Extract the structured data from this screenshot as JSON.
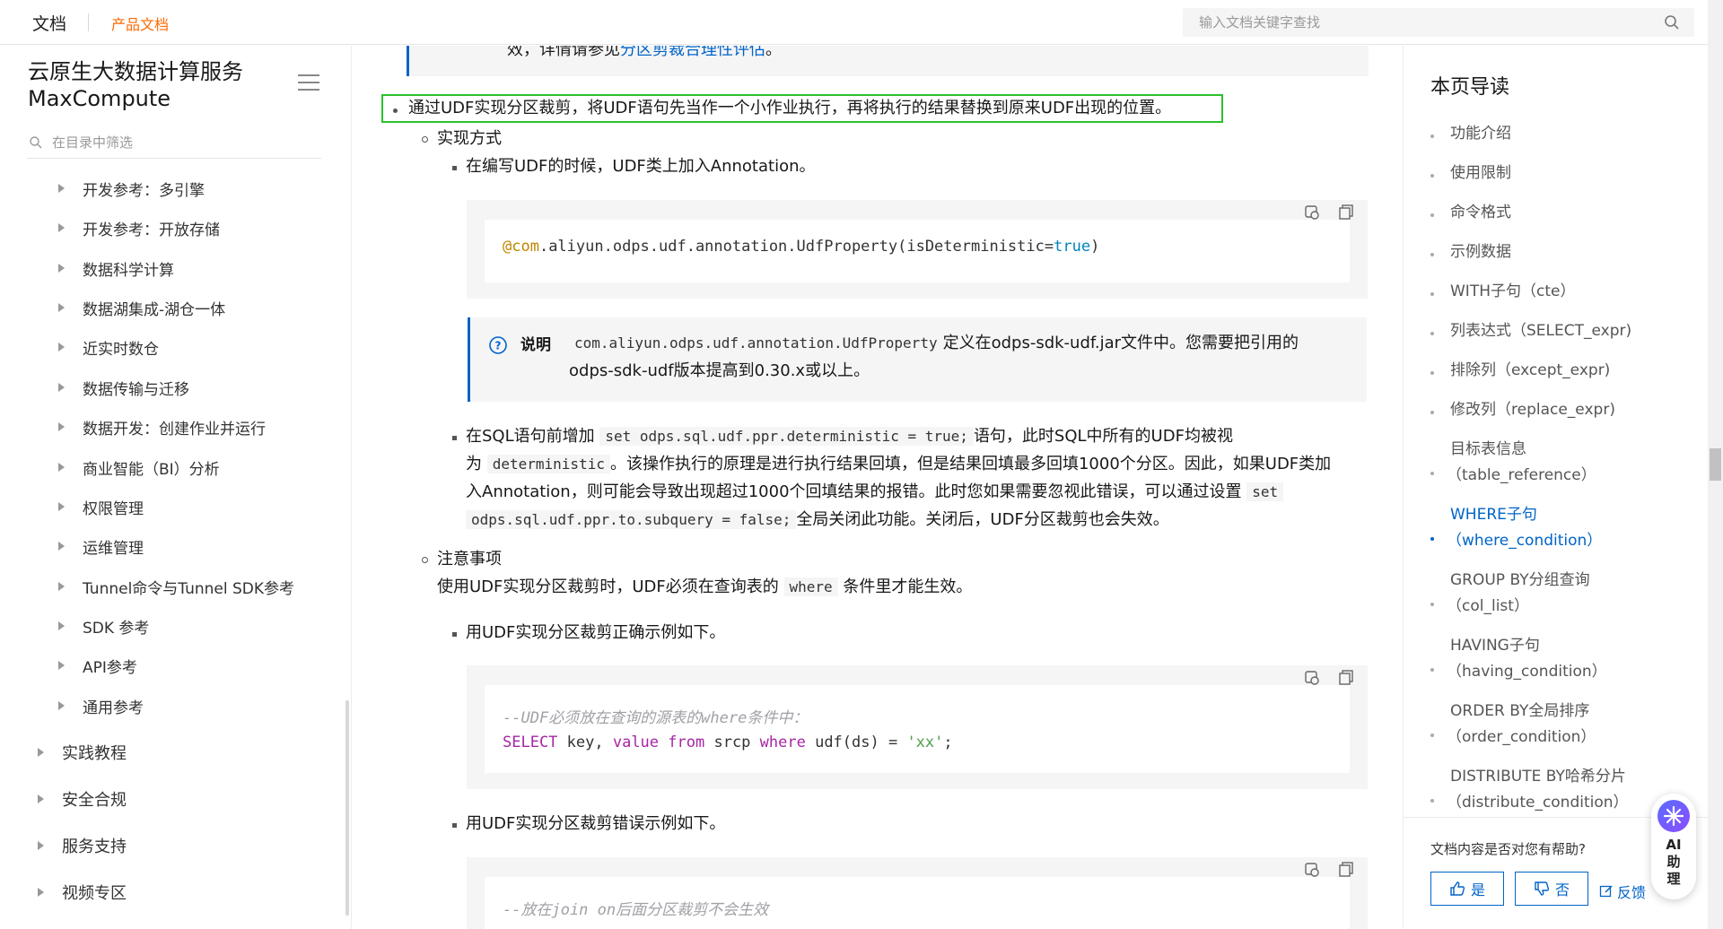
{
  "topbar": {
    "brand": "文档",
    "product": "产品文档",
    "search_placeholder": "输入文档关键字查找"
  },
  "sidebar": {
    "title_line1": "云原生大数据计算服务",
    "title_line2": "MaxCompute",
    "filter_placeholder": "在目录中筛选",
    "items": [
      "开发参考：多引擎",
      "开发参考：开放存储",
      "数据科学计算",
      "数据湖集成-湖仓一体",
      "近实时数仓",
      "数据传输与迁移",
      "数据开发：创建作业并运行",
      "商业智能（BI）分析",
      "权限管理",
      "运维管理",
      "Tunnel命令与Tunnel SDK参考",
      "SDK 参考",
      "API参考",
      "通用参考"
    ],
    "top_items": [
      "实践教程",
      "安全合规",
      "服务支持",
      "视频专区"
    ]
  },
  "content": {
    "top_fragment_a": "效，详情请参见",
    "top_fragment_link": "分区剪裁合理性评估",
    "top_fragment_b": "。",
    "udf_bullet": "通过UDF实现分区裁剪，将UDF语句先当作一个小作业执行，再将执行的结果替换到原来UDF出现的位置。",
    "impl_label": "实现方式",
    "impl_step1": "在编写UDF的时候，UDF类上加入Annotation。",
    "code1_anno": "@com",
    "code1_mid": ".aliyun.odps.udf.annotation.UdfProperty(isDeterministic=",
    "code1_bool": "true",
    "code1_end": ")",
    "note_label": "说明",
    "note_code": "com.aliyun.odps.udf.annotation.UdfProperty",
    "note_text1": "定义在odps-sdk-udf.jar文件中。您需要把引用的",
    "note_text2": "odps-sdk-udf版本提高到0.30.x或以上。",
    "step2_a": "在SQL语句前增加",
    "step2_code1": "set odps.sql.udf.ppr.deterministic = true;",
    "step2_b": "语句，此时SQL中所有的UDF均被视",
    "step2_c": "为",
    "step2_code2": "deterministic",
    "step2_d": "。该操作执行的原理是进行执行结果回填，但是结果回填最多回填1000个分区。因此，如果UDF类加",
    "step2_e": "入Annotation，则可能会导致出现超过1000个回填结果的报错。此时您如果需要忽视此错误，可以通过设置",
    "step2_code3": "set",
    "step2_code4": "odps.sql.udf.ppr.to.subquery = false;",
    "step2_f": "全局关闭此功能。关闭后，UDF分区裁剪也会失效。",
    "notice_label": "注意事项",
    "notice_a": "使用UDF实现分区裁剪时，UDF必须在查询表的",
    "notice_code": "where",
    "notice_b": "条件里才能生效。",
    "correct_label": "用UDF实现分区裁剪正确示例如下。",
    "code2_comment": "--UDF必须放在查询的源表的where条件中：",
    "code2_select": "SELECT",
    "code2_key": " key, ",
    "code2_value": "value",
    "code2_from": "from",
    "code2_srcp": " srcp ",
    "code2_where": "where",
    "code2_udf": " udf(ds) = ",
    "code2_str": "'xx'",
    "code2_semi": ";",
    "wrong_label": "用UDF实现分区裁剪错误示例如下。",
    "code3_comment": "--放在join on后面分区裁剪不会生效"
  },
  "toc": {
    "heading": "本页导读",
    "items": [
      {
        "l1": "功能介绍"
      },
      {
        "l1": "使用限制"
      },
      {
        "l1": "命令格式"
      },
      {
        "l1": "示例数据"
      },
      {
        "l1": "WITH子句（cte）"
      },
      {
        "l1": "列表达式（SELECT_expr)"
      },
      {
        "l1": "排除列（except_expr)"
      },
      {
        "l1": "修改列（replace_expr)"
      },
      {
        "l1": "目标表信息",
        "l2": "（table_reference）"
      },
      {
        "l1": "WHERE子句",
        "l2": "（where_condition）"
      },
      {
        "l1": "GROUP BY分组查询",
        "l2": "（col_list）"
      },
      {
        "l1": "HAVING子句",
        "l2": "（having_condition）"
      },
      {
        "l1": "ORDER BY全局排序",
        "l2": "（order_condition）"
      },
      {
        "l1": "DISTRIBUTE BY哈希分片",
        "l2": "（distribute_condition）"
      }
    ],
    "active_index": 9
  },
  "feedback": {
    "question": "文档内容是否对您有帮助?",
    "yes": "是",
    "no": "否",
    "report": "反馈"
  },
  "ai": {
    "label_line1": "AI",
    "label_line2": "助",
    "label_line3": "理"
  },
  "colors": {
    "accent": "#0064c8",
    "brand": "#ff6a00",
    "highlight": "#2cc12c"
  }
}
